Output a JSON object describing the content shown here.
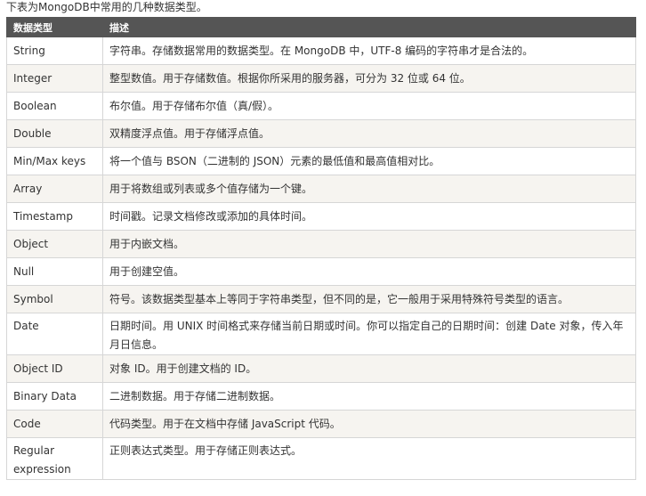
{
  "intro": "下表为MongoDB中常用的几种数据类型。",
  "table": {
    "headers": [
      "数据类型",
      "描述"
    ],
    "rows": [
      {
        "type": "String",
        "desc": "字符串。存储数据常用的数据类型。在 MongoDB 中，UTF-8 编码的字符串才是合法的。"
      },
      {
        "type": "Integer",
        "desc": "整型数值。用于存储数值。根据你所采用的服务器，可分为 32 位或 64 位。"
      },
      {
        "type": "Boolean",
        "desc": "布尔值。用于存储布尔值（真/假）。"
      },
      {
        "type": "Double",
        "desc": "双精度浮点值。用于存储浮点值。"
      },
      {
        "type": "Min/Max keys",
        "desc": "将一个值与 BSON（二进制的 JSON）元素的最低值和最高值相对比。"
      },
      {
        "type": "Array",
        "desc": "用于将数组或列表或多个值存储为一个键。"
      },
      {
        "type": "Timestamp",
        "desc": "时间戳。记录文档修改或添加的具体时间。"
      },
      {
        "type": "Object",
        "desc": "用于内嵌文档。"
      },
      {
        "type": "Null",
        "desc": "用于创建空值。"
      },
      {
        "type": "Symbol",
        "desc": "符号。该数据类型基本上等同于字符串类型，但不同的是，它一般用于采用特殊符号类型的语言。"
      },
      {
        "type": "Date",
        "desc": "日期时间。用 UNIX 时间格式来存储当前日期或时间。你可以指定自己的日期时间：创建 Date 对象，传入年月日信息。"
      },
      {
        "type": "Object ID",
        "desc": "对象 ID。用于创建文档的 ID。"
      },
      {
        "type": "Binary Data",
        "desc": "二进制数据。用于存储二进制数据。"
      },
      {
        "type": "Code",
        "desc": "代码类型。用于在文档中存储 JavaScript 代码。"
      },
      {
        "type": "Regular expression",
        "desc": "正则表达式类型。用于存储正则表达式。"
      }
    ]
  }
}
